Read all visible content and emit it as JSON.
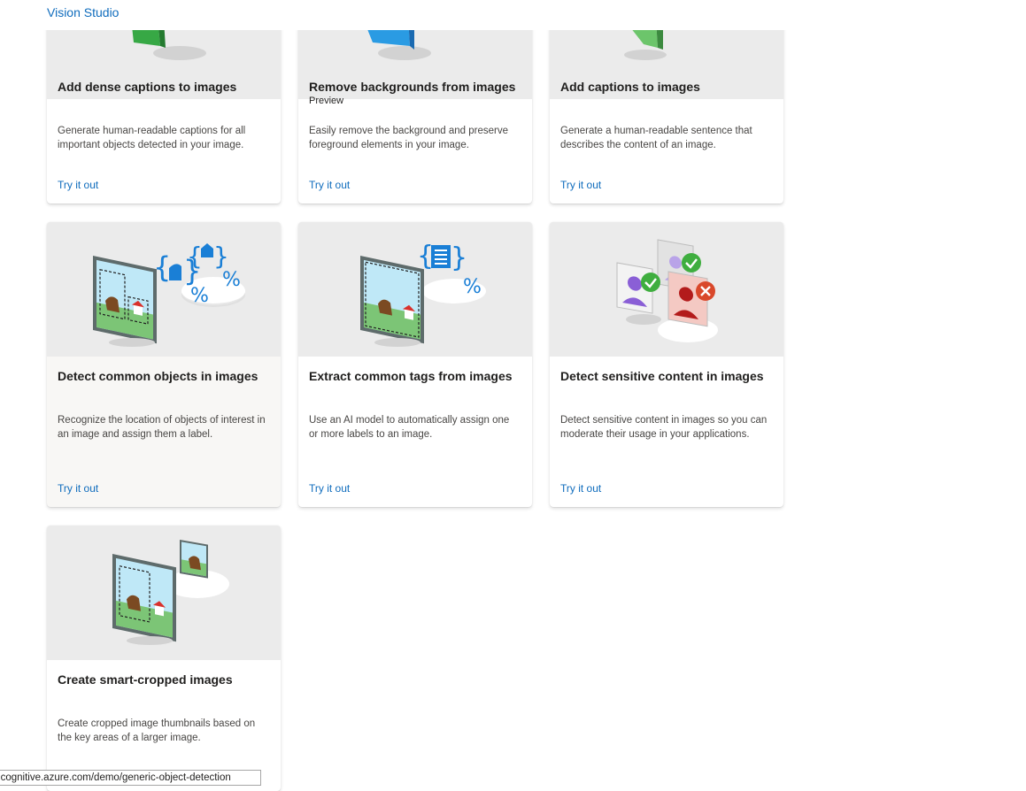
{
  "app": {
    "title": "Vision Studio"
  },
  "cards": [
    {
      "title": "Add dense captions to images",
      "badge": "",
      "description": "Generate human-readable captions for all important objects detected in your image.",
      "cta": "Try it out",
      "icon": "dense-captions-illustration"
    },
    {
      "title": "Remove backgrounds from images",
      "badge": "Preview",
      "description": "Easily remove the background and preserve foreground elements in your image.",
      "cta": "Try it out",
      "icon": "remove-background-illustration"
    },
    {
      "title": "Add captions to images",
      "badge": "",
      "description": "Generate a human-readable sentence that describes the content of an image.",
      "cta": "Try it out",
      "icon": "captions-illustration"
    },
    {
      "title": "Detect common objects in images",
      "badge": "",
      "description": "Recognize the location of objects of interest in an image and assign them a label.",
      "cta": "Try it out",
      "icon": "object-detection-illustration"
    },
    {
      "title": "Extract common tags from images",
      "badge": "",
      "description": "Use an AI model to automatically assign one or more labels to an image.",
      "cta": "Try it out",
      "icon": "tags-illustration"
    },
    {
      "title": "Detect sensitive content in images",
      "badge": "",
      "description": "Detect sensitive content in images so you can moderate their usage in your applications.",
      "cta": "Try it out",
      "icon": "sensitive-content-illustration"
    },
    {
      "title": "Create smart-cropped images",
      "badge": "",
      "description": "Create cropped image thumbnails based on the key areas of a larger image.",
      "cta": "",
      "icon": "smart-crop-illustration"
    }
  ],
  "status_url": "n.cognitive.azure.com/demo/generic-object-detection",
  "colors": {
    "accent": "#0f6cbd",
    "illustration_blue": "#1a7fd6",
    "card_image_bg": "#ebebeb"
  }
}
